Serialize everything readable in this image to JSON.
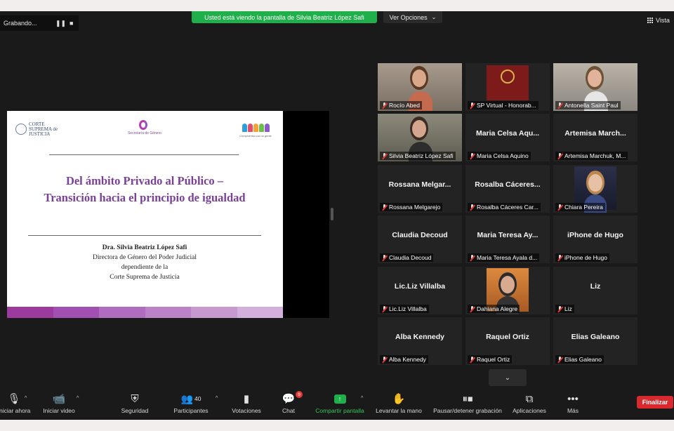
{
  "recording": {
    "label": "Grabando...",
    "pause_icon": "pause-icon",
    "stop_icon": "stop-icon"
  },
  "share_banner": "Usted está viendo la pantalla de Silvia Beatriz López Safi",
  "view_options": {
    "label": "Ver Opciones",
    "chevron": "⌄"
  },
  "view": {
    "label": "Vista"
  },
  "slide": {
    "logo_corte": "CORTE SUPREMA de JUSTICIA",
    "logo_genero": "Secretaría de Género",
    "logo_comp": "Compromiso con la gente",
    "title": "Del ámbito Privado al Público – Transición hacia el principio de igualdad",
    "author": "Dra. Silvia Beatriz López Safi",
    "role1": "Directora de Género del Poder Judicial",
    "role2": "dependiente de la",
    "role3": "Corte Suprema de Justicia",
    "bar_colors": [
      "#9b3b9e",
      "#a14fb0",
      "#b06dc0",
      "#bb82c8",
      "#c69ad1",
      "#d2b0db"
    ]
  },
  "participants": [
    {
      "big": "",
      "label": "Rocío Abed",
      "photo": true
    },
    {
      "big": "",
      "label": "SP Virtual - Honorab...",
      "photo": true
    },
    {
      "big": "",
      "label": "Antonella Saint Paul",
      "photo": true
    },
    {
      "big": "",
      "label": "Silvia Beatriz López Safi",
      "photo": true,
      "active": true
    },
    {
      "big": "Maria Celsa Aqu...",
      "label": "Maria Celsa Aquino"
    },
    {
      "big": "Artemisa March...",
      "label": "Artemisa Marchuk, M..."
    },
    {
      "big": "Rossana Melgar...",
      "label": "Rossana Melgarejo"
    },
    {
      "big": "Rosalba Cáceres...",
      "label": "Rosalba Cáceres Car..."
    },
    {
      "big": "",
      "label": "Chiara Pereira",
      "photo": true
    },
    {
      "big": "Claudia Decoud",
      "label": "Claudia Decoud"
    },
    {
      "big": "Maria Teresa Ay...",
      "label": "Maria Teresa Ayala d..."
    },
    {
      "big": "iPhone de Hugo",
      "label": "iPhone de Hugo"
    },
    {
      "big": "Lic.Liz Villalba",
      "label": "Lic.Liz Villalba"
    },
    {
      "big": "",
      "label": "Dahiana Alegre",
      "photo": true
    },
    {
      "big": "Liz",
      "label": "Liz"
    },
    {
      "big": "Alba Kennedy",
      "label": "Alba Kennedy"
    },
    {
      "big": "Raquel Ortiz",
      "label": "Raquel Ortiz"
    },
    {
      "big": "Elias Galeano",
      "label": "Elias Galeano"
    }
  ],
  "toolbar": {
    "audio": "Iniciar ahora",
    "video": "Iniciar video",
    "security": "Seguridad",
    "participants": "Participantes",
    "participants_count": "40",
    "polls": "Votaciones",
    "chat": "Chat",
    "chat_badge": "9",
    "share": "Compartir pantalla",
    "raise_hand": "Levantar la mano",
    "recording": "Pausar/detener grabación",
    "apps": "Aplicaciones",
    "more": "Más",
    "end": "Finalizar"
  }
}
